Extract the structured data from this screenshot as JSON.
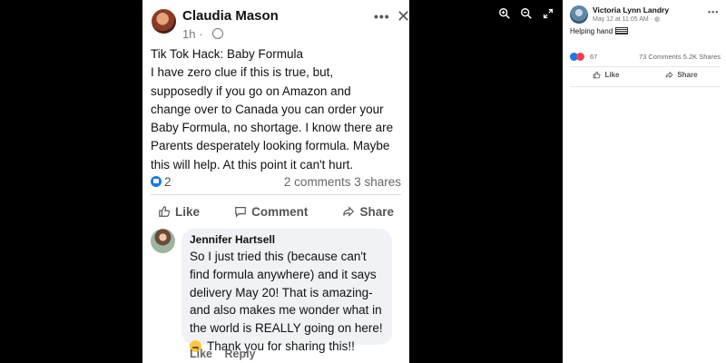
{
  "viewer": {
    "controls": [
      "zoom-in-icon",
      "zoom-out-icon",
      "fullscreen-icon"
    ]
  },
  "photo_post": {
    "author": "Claudia Mason",
    "time": "1h ·",
    "more": "•••",
    "close": "✕",
    "text_lines": [
      "Tik Tok Hack: Baby Formula",
      "I have  zero clue if this is true, but,",
      "supposedly if you go on Amazon and",
      "change over to Canada you can order your",
      "Baby Formula, no shortage. I know there are",
      "Parents desperately looking formula. Maybe",
      "this will help. At this point it can't hurt."
    ],
    "reaction_count": "2",
    "comments": "2 comments",
    "shares": "3 shares",
    "actions": {
      "like": "Like",
      "comment": "Comment",
      "share": "Share"
    },
    "comment": {
      "author": "Jennifer Hartsell",
      "lines": [
        "So I just tried this (because can't",
        "find formula anywhere) and it says",
        "delivery May 20! That is amazing-",
        "and also makes me wonder what in",
        "the world is REALLY going on here!"
      ],
      "last_line": "Thank you for sharing this!!",
      "like": "Like",
      "reply": "Reply"
    }
  },
  "panel": {
    "author": "Victoria Lynn Landry",
    "date": "May 12 at 11:05 AM ·",
    "more": "•••",
    "text": "Helping hand",
    "reaction_count": "67",
    "comments": "73 Comments",
    "shares": "5.2K Shares",
    "actions": {
      "like": "Like",
      "share": "Share"
    }
  }
}
